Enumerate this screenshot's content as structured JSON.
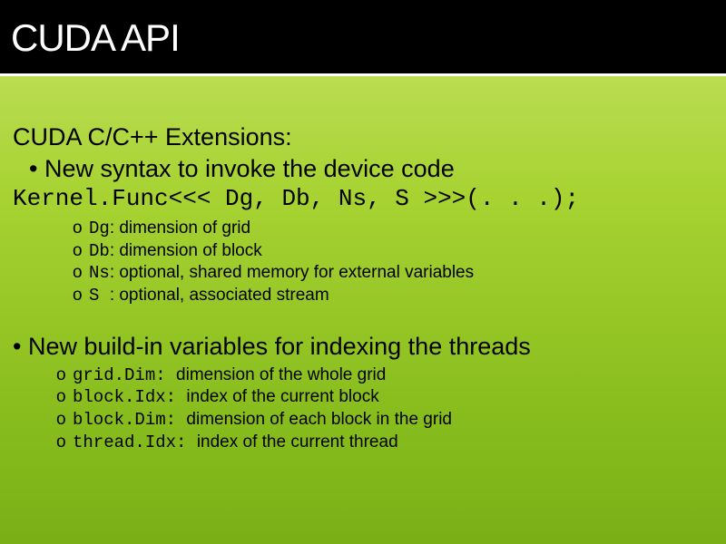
{
  "title": "CUDA API",
  "section1": {
    "heading": "CUDA C/C++ Extensions:",
    "bullet": "New syntax to invoke the device code",
    "code": "Kernel.Func<<< Dg, Db, Ns, S >>>(. . .);",
    "params": [
      {
        "sym": "Dg",
        "desc": ": dimension of grid"
      },
      {
        "sym": "Db",
        "desc": ": dimension of block"
      },
      {
        "sym": "Ns",
        "desc": ": optional, shared memory for external variables"
      },
      {
        "sym": "S ",
        "desc": ": optional, associated stream"
      }
    ]
  },
  "section2": {
    "bullet": "New build-in variables for indexing the threads",
    "vars": [
      {
        "sym": "grid.Dim: ",
        "desc": " dimension of the whole grid"
      },
      {
        "sym": "block.Idx: ",
        "desc": " index of the current block"
      },
      {
        "sym": "block.Dim: ",
        "desc": " dimension of each block in the grid"
      },
      {
        "sym": "thread.Idx: ",
        "desc": " index of the current thread"
      }
    ]
  }
}
